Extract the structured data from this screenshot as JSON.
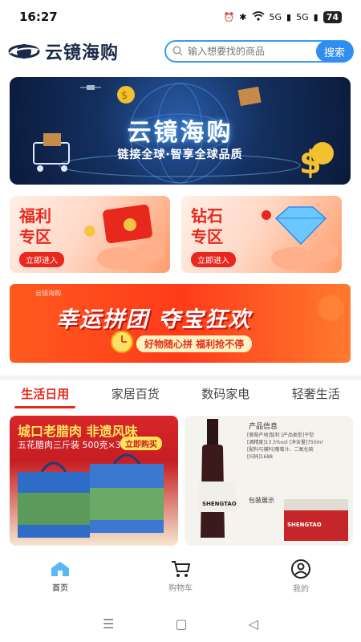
{
  "status_bar": {
    "time": "16:27",
    "net1": "5G",
    "net2": "5G",
    "battery": "74"
  },
  "header": {
    "app_name": "云镜海购",
    "search_placeholder": "输入想要找的商品",
    "search_button": "搜索"
  },
  "hero": {
    "title": "云镜海购",
    "subtitle": "链接全球·智享全球品质"
  },
  "promos": [
    {
      "line1": "福利",
      "line2": "专区",
      "cta": "立即进入"
    },
    {
      "line1": "钻石",
      "line2": "专区",
      "cta": "立即进入"
    }
  ],
  "lucky_banner": {
    "brand": "云镜海购",
    "title": "幸运拼团 夺宝狂欢",
    "tagline": "好物随心拼 福利抢不停"
  },
  "category_tabs": [
    {
      "label": "生活日用",
      "active": true
    },
    {
      "label": "家居百货",
      "active": false
    },
    {
      "label": "数码家电",
      "active": false
    },
    {
      "label": "轻奢生活",
      "active": false
    }
  ],
  "products": [
    {
      "headline": "城口老腊肉 非遗风味",
      "sub": "五花腊肉三斤装 500克×3",
      "cta": "立即购买"
    },
    {
      "info_title": "产品信息",
      "info_lines": [
        "[葡萄产地]智利 [产品类型]干型",
        "[酒精度]13.5%vol [净含量]750ml",
        "[配料与辅料]葡萄汁、二氧化硫",
        "[扫码]1688"
      ],
      "pack_title": "包装展示",
      "label": "SHENGTAO"
    }
  ],
  "bottom_nav": [
    {
      "label": "首页",
      "icon": "home-icon",
      "active": true
    },
    {
      "label": "购物车",
      "icon": "cart-icon",
      "active": false
    },
    {
      "label": "我的",
      "icon": "user-icon",
      "active": false
    }
  ],
  "colors": {
    "accent": "#e8281d",
    "search_blue": "#2f8ef0",
    "hero_dark": "#0b1a3a"
  }
}
